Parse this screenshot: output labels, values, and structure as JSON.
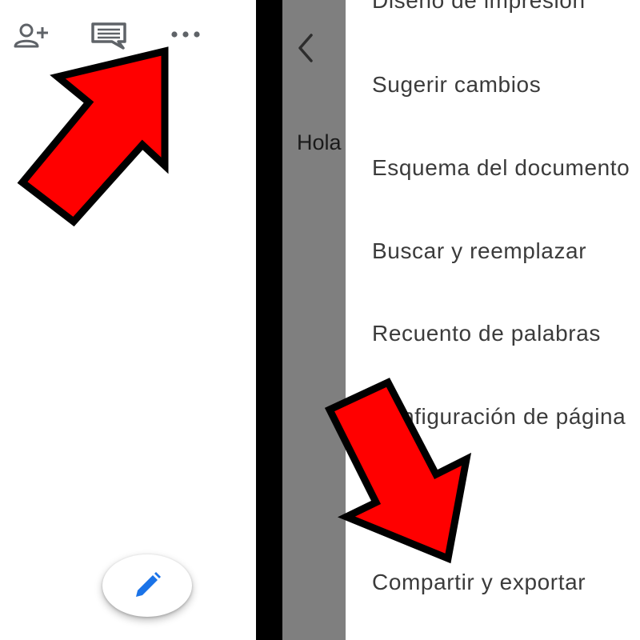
{
  "toolbar": {
    "add_person_icon": "person-add-icon",
    "comment_icon": "comment-icon",
    "more_icon": "more-horizontal-icon"
  },
  "fab": {
    "icon": "pencil-icon",
    "color": "#1a73e8"
  },
  "document": {
    "text": "Hola"
  },
  "menu": {
    "items": [
      {
        "label": "Diseño de impresión"
      },
      {
        "label": "Sugerir cambios"
      },
      {
        "label": "Esquema del documento"
      },
      {
        "label": "Buscar y reemplazar"
      },
      {
        "label": "Recuento de palabras"
      },
      {
        "label": "Configuración de página"
      },
      {
        "label": "Compartir y exportar"
      }
    ]
  },
  "colors": {
    "annotation_arrow": "#ff0000",
    "dim_overlay": "#7f7f7f",
    "menu_text": "#3b3b3b",
    "icon_gray": "#5f6368"
  }
}
